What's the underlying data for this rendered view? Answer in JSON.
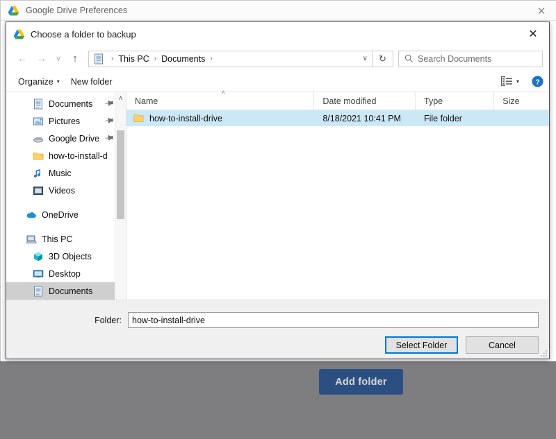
{
  "host_window": {
    "title": "Google Drive Preferences",
    "close_label": "✕",
    "add_folder_label": "Add folder",
    "accent_color": "#2c4f82"
  },
  "dialog": {
    "title": "Choose a folder to backup",
    "close_label": "✕",
    "nav": {
      "back": "←",
      "forward": "→",
      "recent": "∨",
      "up": "↑",
      "refresh": "↻",
      "address_chevron": "∨",
      "breadcrumbs": [
        "This PC",
        "Documents"
      ],
      "breadcrumb_separator": "›",
      "trailing_separator": "›"
    },
    "search": {
      "placeholder": "Search Documents"
    },
    "command_bar": {
      "organize_label": "Organize",
      "organize_caret": "▾",
      "new_folder_label": "New folder",
      "view_caret": "▾",
      "help_label": "?"
    },
    "sidebar": {
      "items": [
        {
          "label": "Documents",
          "icon": "documents-icon",
          "pinned": true,
          "indent": 2,
          "selected": false
        },
        {
          "label": "Pictures",
          "icon": "pictures-icon",
          "pinned": true,
          "indent": 2,
          "selected": false
        },
        {
          "label": "Google Drive",
          "icon": "drive-shortcut-icon",
          "pinned": true,
          "indent": 2,
          "selected": false
        },
        {
          "label": "how-to-install-d",
          "icon": "folder-icon",
          "pinned": false,
          "indent": 2,
          "selected": false
        },
        {
          "label": "Music",
          "icon": "music-icon",
          "pinned": false,
          "indent": 2,
          "selected": false
        },
        {
          "label": "Videos",
          "icon": "videos-icon",
          "pinned": false,
          "indent": 2,
          "selected": false
        },
        {
          "label": "OneDrive",
          "icon": "onedrive-icon",
          "pinned": false,
          "indent": 1,
          "selected": false,
          "spacer_before": true
        },
        {
          "label": "This PC",
          "icon": "this-pc-icon",
          "pinned": false,
          "indent": 1,
          "selected": false,
          "spacer_before": true
        },
        {
          "label": "3D Objects",
          "icon": "3d-objects-icon",
          "pinned": false,
          "indent": 2,
          "selected": false
        },
        {
          "label": "Desktop",
          "icon": "desktop-icon",
          "pinned": false,
          "indent": 2,
          "selected": false
        },
        {
          "label": "Documents",
          "icon": "documents-icon",
          "pinned": false,
          "indent": 2,
          "selected": true
        }
      ],
      "scroll_up": "∧",
      "scroll_down": "∨"
    },
    "file_list": {
      "columns": [
        "Name",
        "Date modified",
        "Type",
        "Size"
      ],
      "sort_indicator": "∧",
      "rows": [
        {
          "name": "how-to-install-drive",
          "date_modified": "8/18/2021 10:41 PM",
          "type": "File folder",
          "size": "",
          "selected": true
        }
      ],
      "hscroll_left": "‹",
      "hscroll_right": "›"
    },
    "footer": {
      "folder_label": "Folder:",
      "folder_value": "how-to-install-drive",
      "select_folder_label": "Select Folder",
      "cancel_label": "Cancel"
    }
  }
}
